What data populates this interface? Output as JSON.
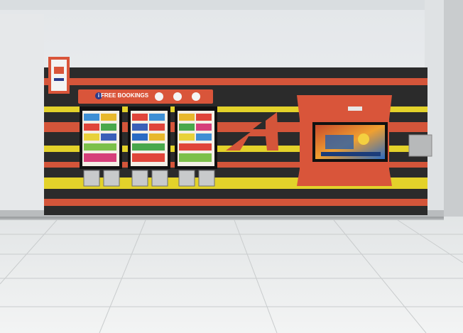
{
  "scene": {
    "free_bookings_label": "FREE BOOKINGS",
    "info_badge": "i"
  },
  "colors": {
    "wall": "#eceef0",
    "stripe_red": "#d4553a",
    "stripe_yellow": "#e3d22a",
    "stripe_black": "#2b2b2b",
    "floor": "#ecefef"
  }
}
